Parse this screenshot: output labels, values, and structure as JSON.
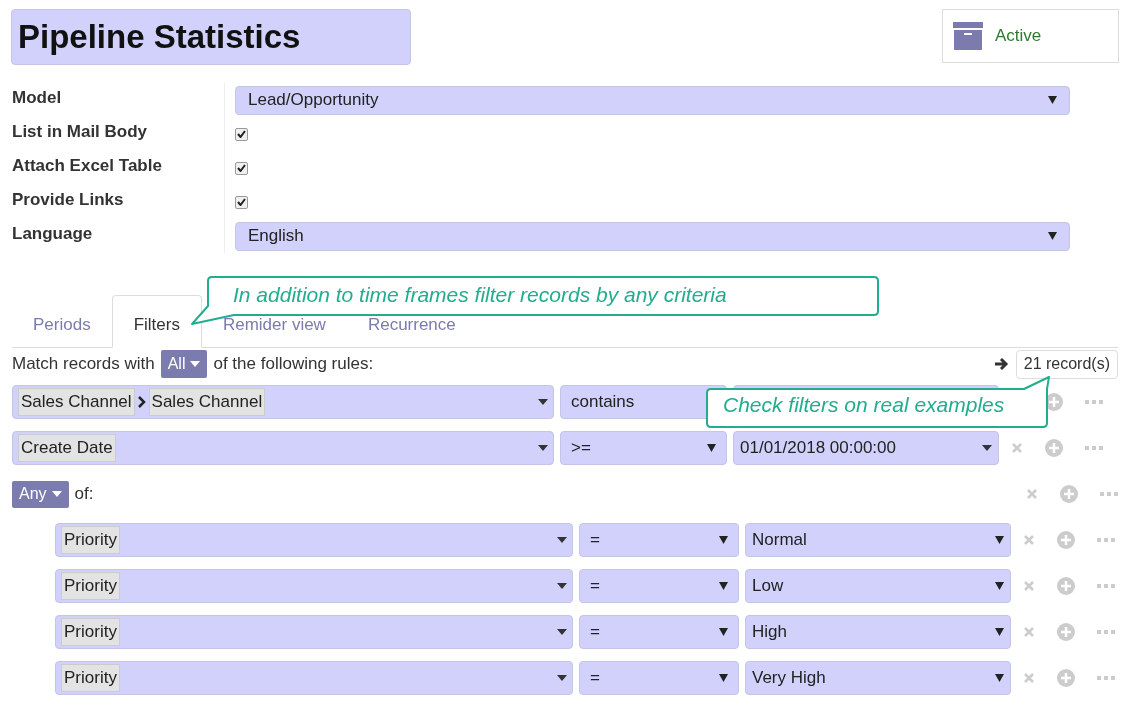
{
  "title": "Pipeline Statistics",
  "status_button": {
    "label": "Active"
  },
  "fields": [
    {
      "label": "Model",
      "kind": "select",
      "value": "Lead/Opportunity"
    },
    {
      "label": "List in Mail Body",
      "kind": "checkbox",
      "checked": true
    },
    {
      "label": "Attach Excel Table",
      "kind": "checkbox",
      "checked": true
    },
    {
      "label": "Provide Links",
      "kind": "checkbox",
      "checked": true
    },
    {
      "label": "Language",
      "kind": "select",
      "value": "English"
    }
  ],
  "tabs": [
    {
      "label": "Periods",
      "selected": false
    },
    {
      "label": "Filters",
      "selected": true
    },
    {
      "label": "Remider view",
      "selected": false
    },
    {
      "label": "Recurrence",
      "selected": false
    }
  ],
  "tabs_callout": "In addition to time frames filter records by any criteria",
  "match": {
    "prefix": "Match records with",
    "mode": "All",
    "suffix": "of the following rules:",
    "records": "21 record(s)"
  },
  "rules": [
    {
      "kind": "rule",
      "path": [
        "Sales Channel",
        "Sales Channel"
      ],
      "operator": "contains",
      "callout": "Check filters on real examples"
    },
    {
      "kind": "rule",
      "path": [
        "Create Date"
      ],
      "operator": ">=",
      "value": "01/01/2018 00:00:00"
    },
    {
      "kind": "group",
      "mode": "Any",
      "label": "of:",
      "children": [
        {
          "kind": "rule",
          "path": [
            "Priority"
          ],
          "operator": "=",
          "value": "Normal"
        },
        {
          "kind": "rule",
          "path": [
            "Priority"
          ],
          "operator": "=",
          "value": "Low"
        },
        {
          "kind": "rule",
          "path": [
            "Priority"
          ],
          "operator": "=",
          "value": "High"
        },
        {
          "kind": "rule",
          "path": [
            "Priority"
          ],
          "operator": "=",
          "value": "Very High"
        }
      ]
    }
  ]
}
